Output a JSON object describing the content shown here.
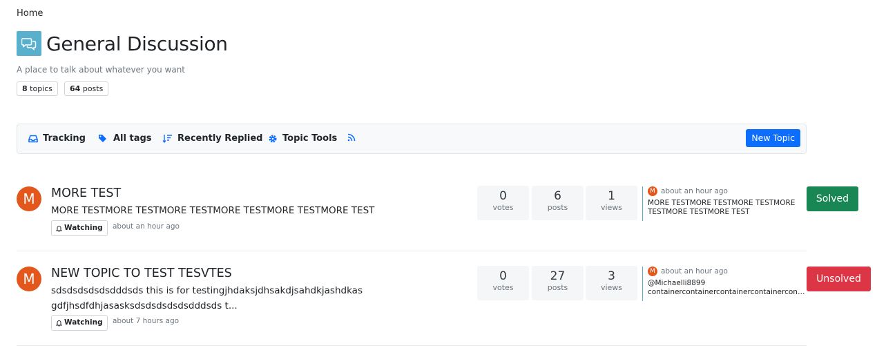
{
  "breadcrumb": {
    "home": "Home"
  },
  "category": {
    "title": "General Discussion",
    "description": "A place to talk about whatever you want",
    "topics_count": "8",
    "topics_label": "topics",
    "posts_count": "64",
    "posts_label": "posts",
    "icon": "comments-icon",
    "icon_bg": "#59b0cd"
  },
  "toolbar": {
    "tracking": "Tracking",
    "all_tags": "All tags",
    "sort": "Recently Replied",
    "topic_tools": "Topic Tools",
    "new_topic": "New Topic",
    "accent": "#0d6efd"
  },
  "topics": [
    {
      "avatar_letter": "M",
      "title": "MORE TEST",
      "teaser": "MORE TESTMORE TESTMORE TESTMORE TESTMORE TESTMORE TEST",
      "watch_label": "Watching",
      "time": "about an hour ago",
      "votes": "0",
      "votes_label": "votes",
      "posts": "6",
      "posts_label": "posts",
      "views": "1",
      "views_label": "views",
      "last_post": {
        "avatar_letter": "M",
        "time": "about an hour ago",
        "text": "MORE TESTMORE TESTMORE TESTMORE TESTMORE TESTMORE TEST"
      },
      "status": "Solved"
    },
    {
      "avatar_letter": "M",
      "title": "NEW TOPIC TO TEST TESVTES",
      "teaser": "sdsdsdsdsdsdddsds this is for testingjhdaksjdhsakdjsahdkjashdkas gdfjhsdfdhjasasksdsdsdsdsdsdddsds t...",
      "watch_label": "Watching",
      "time": "about 7 hours ago",
      "votes": "0",
      "votes_label": "votes",
      "posts": "27",
      "posts_label": "posts",
      "views": "3",
      "views_label": "views",
      "last_post": {
        "avatar_letter": "M",
        "time": "about an hour ago",
        "mention": "@Michaelli8899",
        "text": "containercontainercontainercontainercontainercontainer"
      },
      "status": "Unsolved"
    }
  ],
  "colors": {
    "solved": "#198754",
    "unsolved": "#dc3545",
    "avatar": "#e4571c"
  }
}
